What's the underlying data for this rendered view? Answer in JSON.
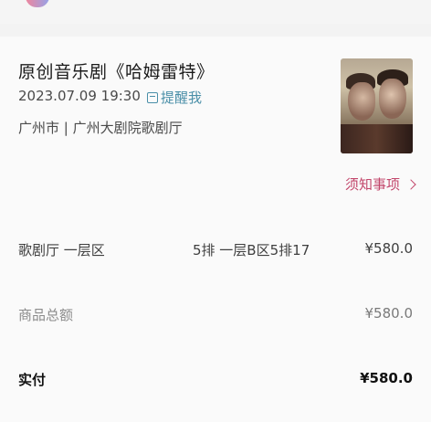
{
  "show": {
    "title": "原创音乐剧《哈姆雷特》",
    "datetime": "2023.07.09 19:30",
    "remind_label": "提醒我",
    "venue": "广州市 | 广州大剧院歌剧厅",
    "poster_icon": "poster-image"
  },
  "notice": {
    "label": "须知事项"
  },
  "order": {
    "seat": {
      "area": "歌剧厅 一层区",
      "seat": "5排 一层B区5排17",
      "price": "¥580.0"
    },
    "subtotal": {
      "label": "商品总额",
      "amount": "¥580.0"
    },
    "paid": {
      "label": "实付",
      "amount": "¥580.0"
    }
  },
  "colors": {
    "accent_pink": "#c2466b",
    "link_blue": "#4a8fa8"
  }
}
